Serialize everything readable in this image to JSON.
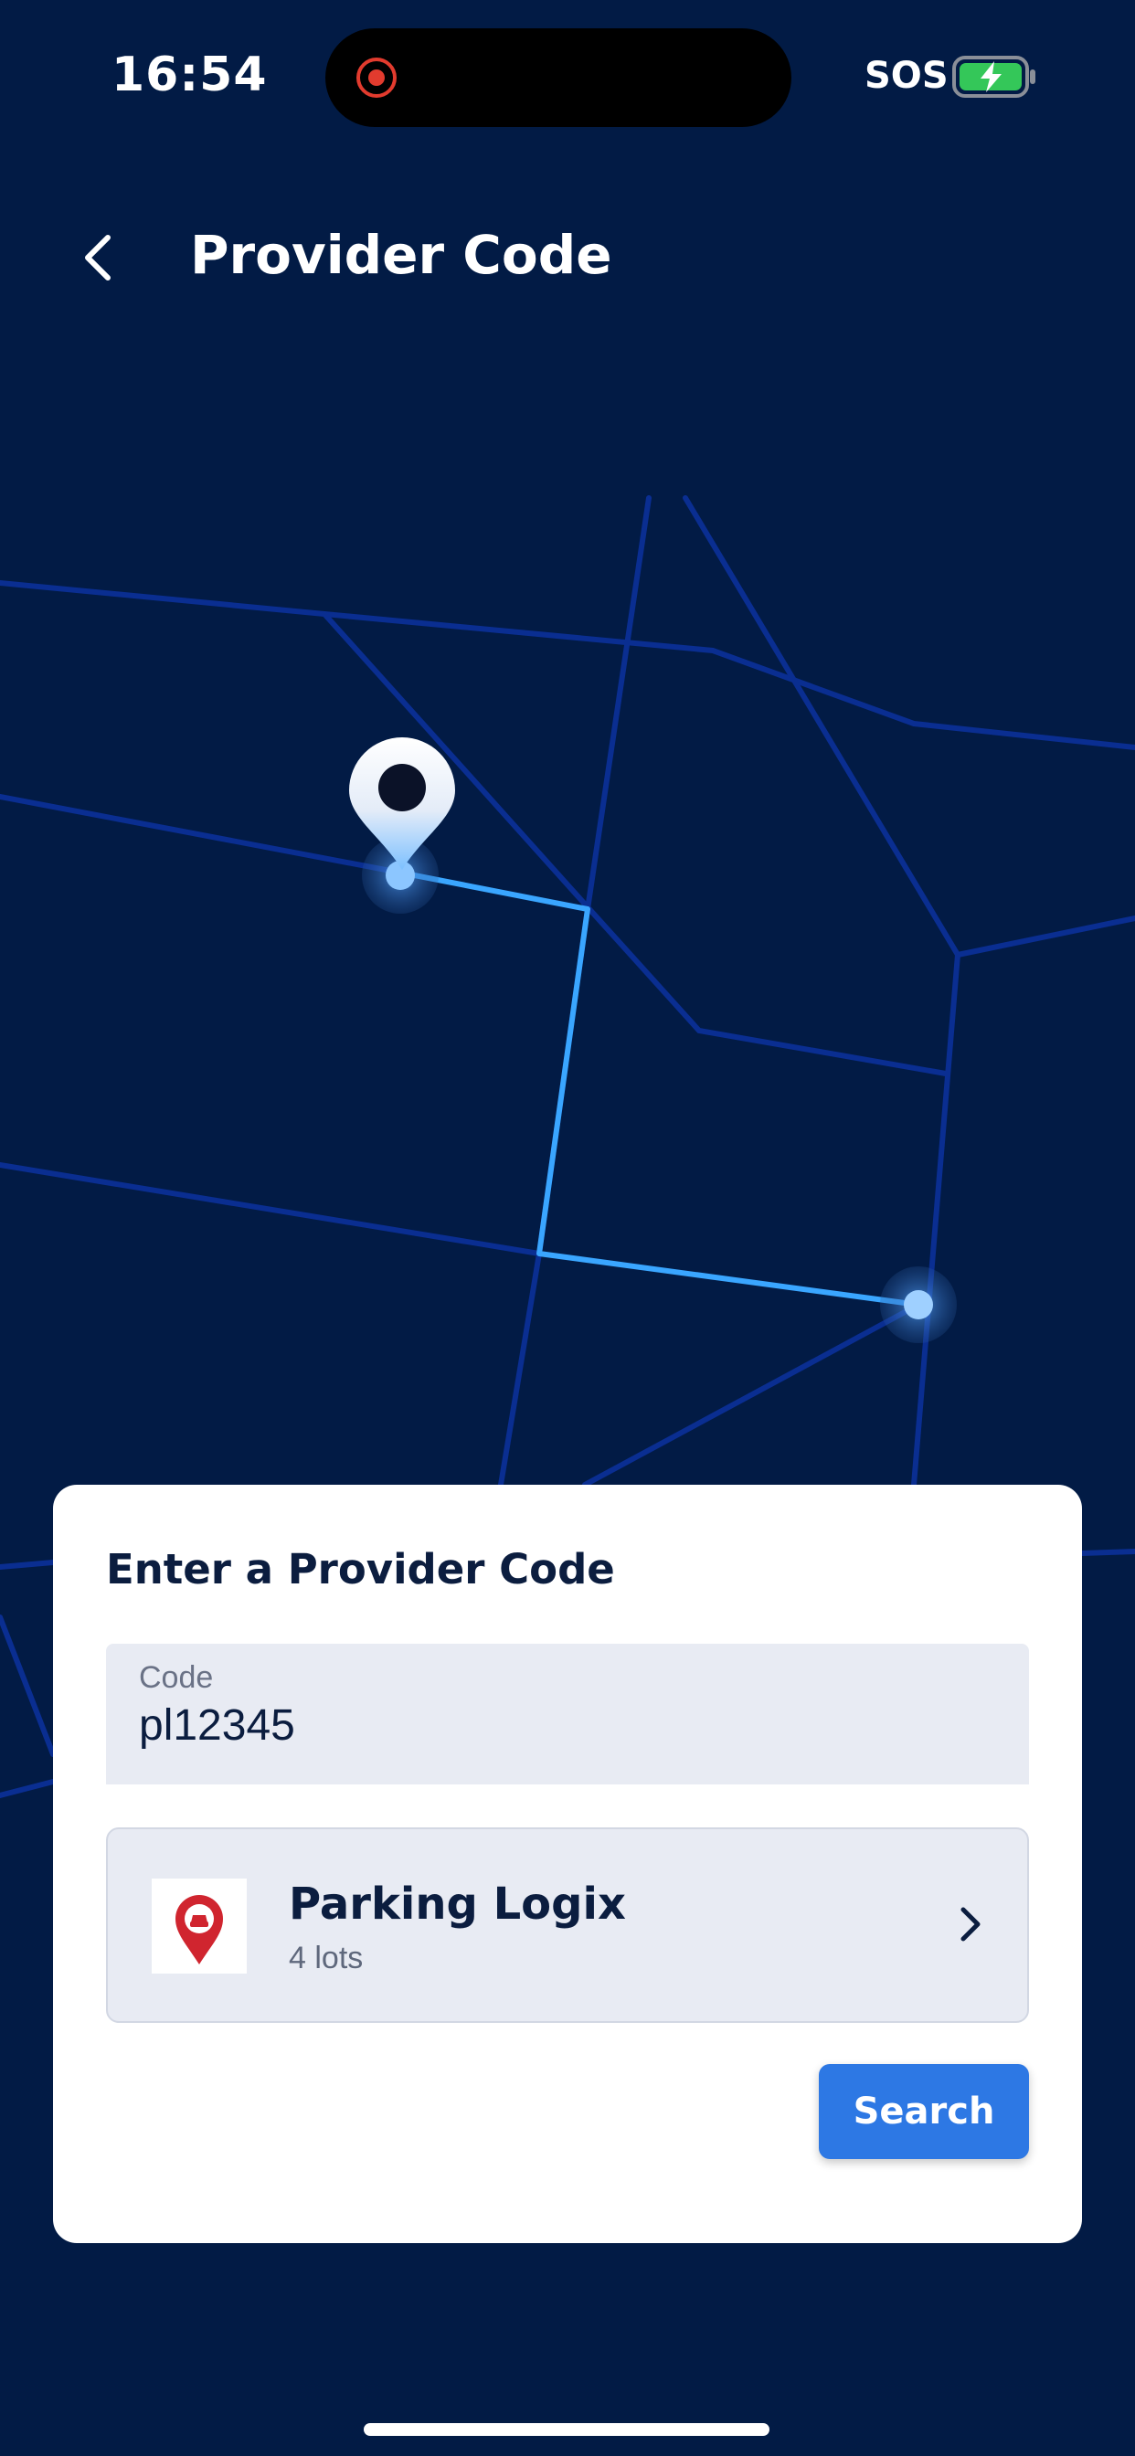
{
  "status_bar": {
    "time": "16:54",
    "carrier": "SOS"
  },
  "header": {
    "title": "Provider Code"
  },
  "card": {
    "title": "Enter a Provider Code",
    "code_field": {
      "label": "Code",
      "value": "pl12345"
    },
    "provider": {
      "name": "Parking Logix",
      "lots": "4 lots"
    },
    "search_label": "Search"
  },
  "colors": {
    "background": "#021b45",
    "road": "#0a2e91",
    "route": "#3aa6ff",
    "accent": "#2d78e4",
    "logo_red": "#d0252f",
    "battery_green": "#34c759"
  },
  "icons": [
    "back-chevron-icon",
    "record-indicator-icon",
    "battery-charging-icon",
    "map-pin-icon",
    "parking-logo-icon",
    "chevron-right-icon"
  ]
}
